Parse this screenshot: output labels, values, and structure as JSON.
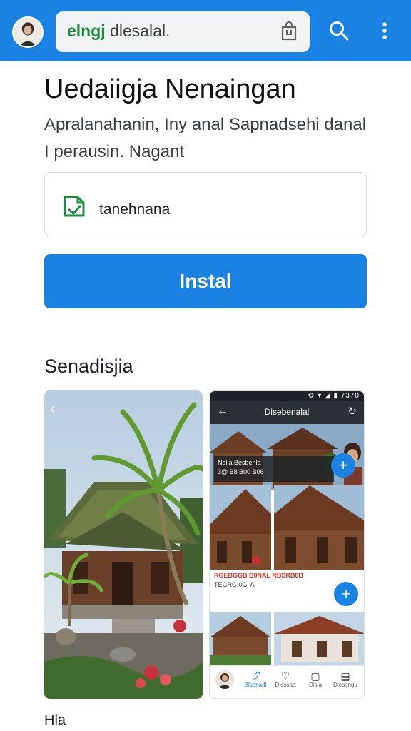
{
  "header": {
    "search_brand": "elngj",
    "search_text": " dlesalal.",
    "icons": [
      "avatar",
      "shopping-bag-icon",
      "search-icon",
      "more-vert-icon"
    ],
    "bar_color": "#1a82e2"
  },
  "app": {
    "title": "Uedaiigja Nenaingan",
    "description": "Apralanahanin, Iny anal Sapnadsehi danal I perausin. Nagant",
    "developer": "tanehnana",
    "install_label": "Instal",
    "accent_color": "#1a82e2"
  },
  "screenshots": {
    "section_title": "Senadisjia",
    "phone": {
      "status_icons": "⚙ ▾ ◢ ▮ 7370",
      "app_title": "Dlsebenalal",
      "caption_line1": "Nalla Besbenla",
      "caption_line2": "3@ B8 B00 B06",
      "info_line1": "RGEBGGB B0NAL RBSRB0B",
      "info_line2": "TEGRGI0Gl A",
      "nav": [
        {
          "icon": "⤴",
          "label": "Blsenadl",
          "active": true
        },
        {
          "icon": "♡",
          "label": "Dlessaa",
          "active": false
        },
        {
          "icon": "▢",
          "label": "Dlsla",
          "active": false
        },
        {
          "icon": "▤",
          "label": "Dlesangu",
          "active": false
        }
      ]
    }
  },
  "bottom_label": "Hla"
}
